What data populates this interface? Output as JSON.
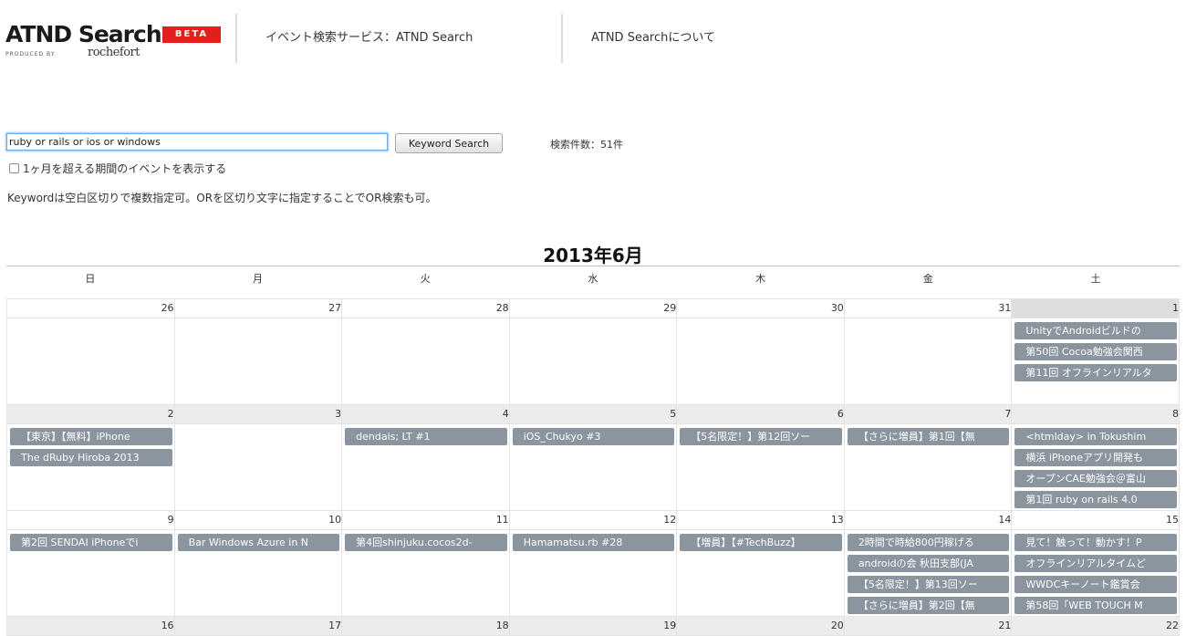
{
  "header": {
    "logo_text": "ATND Search",
    "beta_label": "BETA",
    "produced_by": "PRODUCED BY",
    "brand": "rochefort",
    "nav": [
      {
        "label": "イベント検索サービス：ATND Search"
      },
      {
        "label": "ATND Searchについて"
      }
    ]
  },
  "search": {
    "query": "ruby or rails or ios or windows",
    "button_label": "Keyword Search",
    "result_count": "検索件数：51件",
    "option_label": "1ヶ月を超える期間のイベントを表示する",
    "help_text": "Keywordは空白区切りで複数指定可。ORを区切り文字に指定することでOR検索も可。"
  },
  "calendar": {
    "title": "2013年6月",
    "weekdays": [
      "日",
      "月",
      "火",
      "水",
      "木",
      "金",
      "土"
    ],
    "weeks": [
      {
        "days": [
          {
            "num": "26",
            "events": []
          },
          {
            "num": "27",
            "events": []
          },
          {
            "num": "28",
            "events": []
          },
          {
            "num": "29",
            "events": []
          },
          {
            "num": "30",
            "events": []
          },
          {
            "num": "31",
            "events": []
          },
          {
            "num": "1",
            "events": [
              "UnityでAndroidビルドの",
              "第50回 Cocoa勉強会関西",
              "第11回 オフラインリアルタ"
            ]
          }
        ]
      },
      {
        "days": [
          {
            "num": "2",
            "events": [
              "【東京】【無料】iPhone",
              "The dRuby Hiroba 2013"
            ]
          },
          {
            "num": "3",
            "events": []
          },
          {
            "num": "4",
            "events": [
              "dendais; LT #1"
            ]
          },
          {
            "num": "5",
            "events": [
              "iOS_Chukyo #3"
            ]
          },
          {
            "num": "6",
            "events": [
              "【5名限定！】第12回ソー"
            ]
          },
          {
            "num": "7",
            "events": [
              "【さらに増員】第1回【無"
            ]
          },
          {
            "num": "8",
            "events": [
              "<htmlday> in Tokushim",
              "横浜 iPhoneアプリ開発も",
              "オープンCAE勉強会＠富山",
              "第1回 ruby on rails 4.0"
            ]
          }
        ]
      },
      {
        "days": [
          {
            "num": "9",
            "events": [
              "第2回 SENDAI iPhoneでi"
            ]
          },
          {
            "num": "10",
            "events": [
              "Bar Windows Azure in N"
            ]
          },
          {
            "num": "11",
            "events": [
              "第4回shinjuku.cocos2d-"
            ]
          },
          {
            "num": "12",
            "events": [
              "Hamamatsu.rb #28"
            ]
          },
          {
            "num": "13",
            "events": [
              "【増員】【#TechBuzz】"
            ]
          },
          {
            "num": "14",
            "events": [
              "2時間で時給800円稼げる",
              "androidの会 秋田支部(JA",
              "【5名限定！】第13回ソー",
              "【さらに増員】第2回【無"
            ]
          },
          {
            "num": "15",
            "events": [
              "見て！触って！動かす！P",
              "オフラインリアルタイムど",
              "WWDCキーノート鑑賞会",
              "第58回「WEB TOUCH M"
            ]
          }
        ]
      },
      {
        "days": [
          {
            "num": "16",
            "events": []
          },
          {
            "num": "17",
            "events": []
          },
          {
            "num": "18",
            "events": []
          },
          {
            "num": "19",
            "events": []
          },
          {
            "num": "20",
            "events": []
          },
          {
            "num": "21",
            "events": []
          },
          {
            "num": "22",
            "events": []
          }
        ]
      }
    ]
  }
}
